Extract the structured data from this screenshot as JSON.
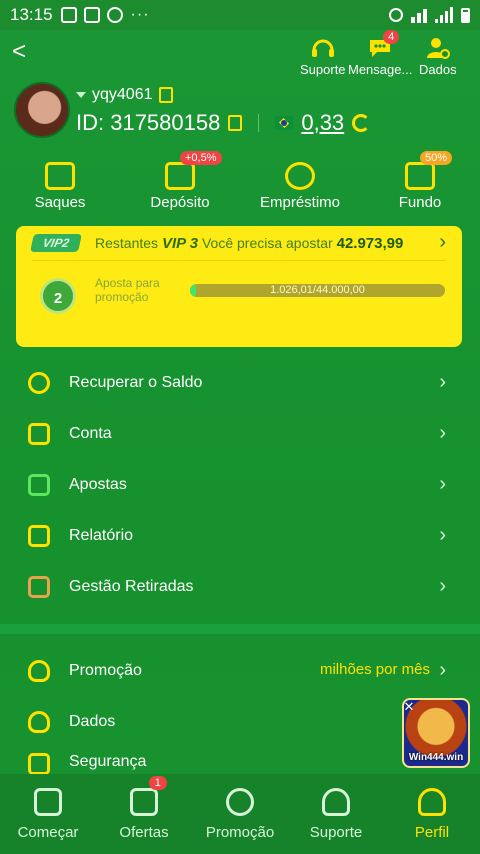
{
  "statusbar": {
    "time": "13:15",
    "dots": "···"
  },
  "header": {
    "back": "<",
    "support_label": "Suporte",
    "messages_label": "Mensage...",
    "messages_badge": "4",
    "data_label": "Dados"
  },
  "profile": {
    "username": "yqy4061",
    "id_label": "ID: 317580158",
    "balance": "0,33"
  },
  "quick_actions": [
    {
      "label": "Saques",
      "badge": ""
    },
    {
      "label": "Depósito",
      "badge": "+0,5%"
    },
    {
      "label": "Empréstimo",
      "badge": ""
    },
    {
      "label": "Fundo",
      "badge": "50%"
    }
  ],
  "vip": {
    "tag": "VIP2",
    "remaining_prefix": "Restantes",
    "target_level": "VIP 3",
    "remaining_middle": "Você precisa apostar",
    "remaining_amount": "42.973,99",
    "level_number": "2",
    "bet_label_line1": "Aposta para",
    "bet_label_line2": "promoção",
    "progress_text": "1.026,01/44.000,00",
    "progress_fraction": 0.0233
  },
  "menu": [
    {
      "label": "Recuperar o Saldo",
      "icon": "coins-icon"
    },
    {
      "label": "Conta",
      "icon": "account-icon"
    },
    {
      "label": "Apostas",
      "icon": "bets-icon"
    },
    {
      "label": "Relatório",
      "icon": "report-icon"
    },
    {
      "label": "Gestão Retiradas",
      "icon": "withdraw-management-icon"
    }
  ],
  "menu2": [
    {
      "label": "Promoção",
      "right_text": "milhões por mês",
      "icon": "promotion-person-icon"
    },
    {
      "label": "Dados",
      "right_text": "",
      "icon": "data-person-icon"
    },
    {
      "label": "Segurança",
      "right_text": "",
      "icon": "security-icon"
    }
  ],
  "floating_ad": {
    "label": "Win444.win",
    "close": "✕"
  },
  "tabs": [
    {
      "label": "Começar",
      "badge": ""
    },
    {
      "label": "Ofertas",
      "badge": "1"
    },
    {
      "label": "Promoção",
      "badge": ""
    },
    {
      "label": "Suporte",
      "badge": ""
    },
    {
      "label": "Perfil",
      "badge": ""
    }
  ],
  "colors": {
    "brand_green": "#17922f",
    "accent_yellow": "#ffe100",
    "badge_red": "#ef4444"
  }
}
